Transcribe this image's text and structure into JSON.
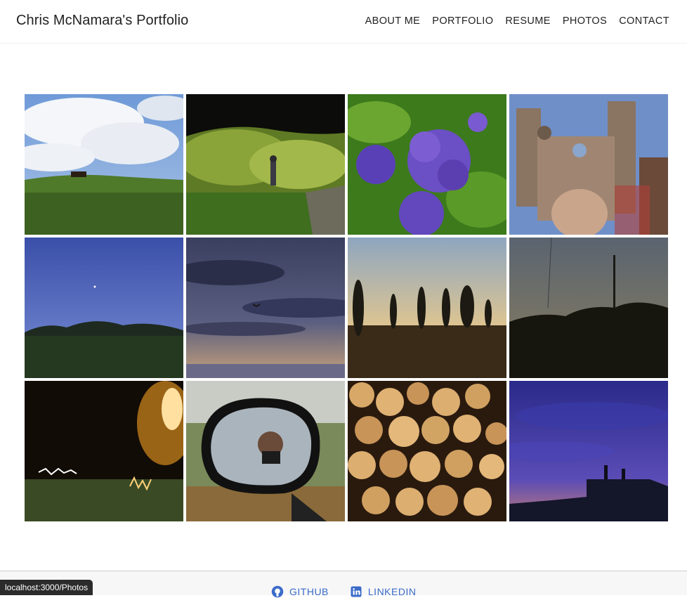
{
  "header": {
    "title": "Chris McNamara's Portfolio",
    "nav": [
      "ABOUT ME",
      "PORTFOLIO",
      "RESUME",
      "PHOTOS",
      "CONTACT"
    ]
  },
  "gallery": {
    "photos": [
      "clouds-hill-horse",
      "cave-hiker",
      "purple-hydrangea",
      "cathedral-reflection",
      "dusk-moon-field",
      "sunset-clouds-bird",
      "cypress-sunset",
      "tree-silhouette-dusk",
      "night-light-trails",
      "car-mirror-selfie",
      "stacked-logs",
      "blue-sky-silhouettes"
    ]
  },
  "footer": {
    "github_label": "GITHUB",
    "linkedin_label": "LINKEDIN"
  },
  "status": {
    "url": "localhost:3000/Photos"
  },
  "colors": {
    "link": "#3b6bc9",
    "text": "#222222"
  }
}
